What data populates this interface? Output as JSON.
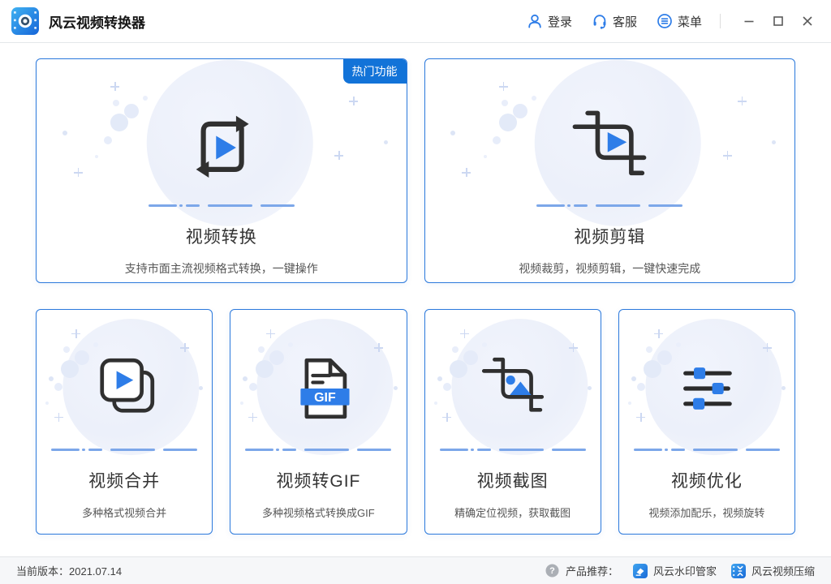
{
  "colors": {
    "primary": "#1273d8",
    "accent": "#2e7de8",
    "card-border": "#2b79dc",
    "dash": "#7ca7e9",
    "icon-dark": "#303030"
  },
  "titlebar": {
    "app_title": "风云视频转换器",
    "login": "登录",
    "support": "客服",
    "menu": "菜单"
  },
  "cards": {
    "featured": [
      {
        "title": "视频转换",
        "subtitle": "支持市面主流视频格式转换，一键操作",
        "badge": "热门功能"
      },
      {
        "title": "视频剪辑",
        "subtitle": "视频裁剪，视频剪辑，一键快速完成"
      }
    ],
    "small": [
      {
        "title": "视频合并",
        "subtitle": "多种格式视频合并"
      },
      {
        "title": "视频转GIF",
        "subtitle": "多种视频格式转换成GIF",
        "gif_label": "GIF"
      },
      {
        "title": "视频截图",
        "subtitle": "精确定位视频，获取截图"
      },
      {
        "title": "视频优化",
        "subtitle": "视频添加配乐，视频旋转"
      }
    ]
  },
  "statusbar": {
    "version": "当前版本：2021.07.14",
    "help_glyph": "?",
    "recommend_label": "产品推荐：",
    "products": [
      "风云水印管家",
      "风云视频压缩"
    ]
  }
}
